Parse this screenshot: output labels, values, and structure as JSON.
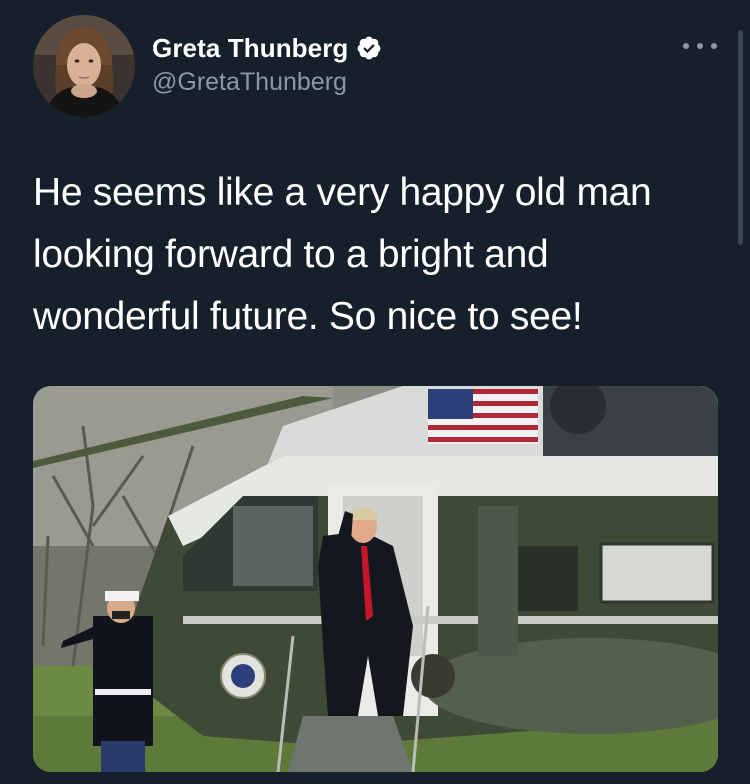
{
  "author": {
    "display_name": "Greta Thunberg",
    "handle": "@GretaThunberg",
    "verified": true,
    "avatar_icon": "profile-photo"
  },
  "tweet": {
    "text": "He seems like a very happy old man looking forward to a bright and wonderful future. So nice to see!",
    "more_icon": "more-options-icon"
  },
  "media": {
    "type": "photo",
    "description_icon": "photo"
  },
  "colors": {
    "background": "#15202b",
    "text": "#ffffff",
    "secondary_text": "#8899a6",
    "verified_badge": "#ffffff"
  }
}
